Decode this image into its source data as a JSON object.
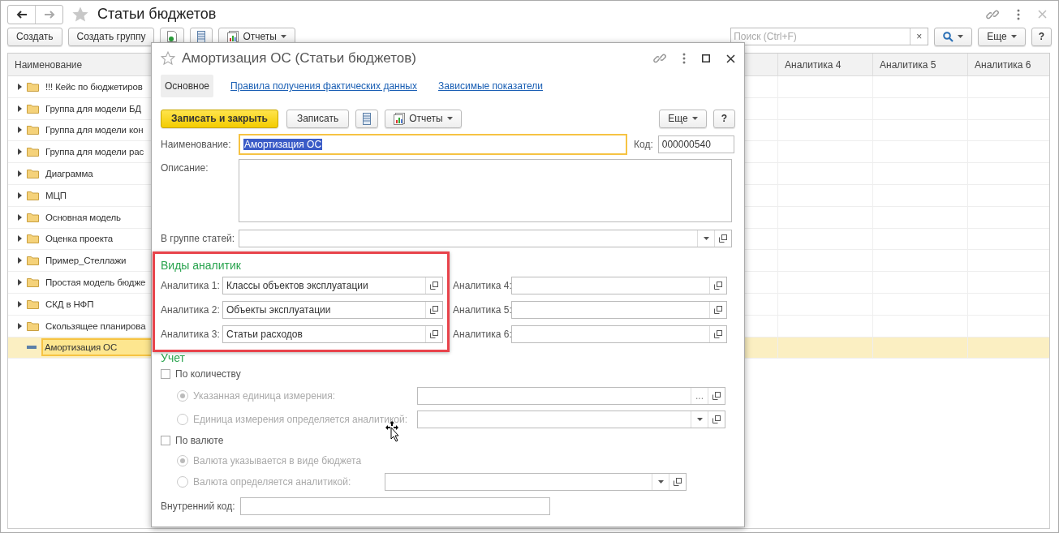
{
  "window": {
    "title": "Статьи бюджетов",
    "favorite": false
  },
  "toolbar": {
    "buttons": [
      "Создать",
      "Создать группу"
    ],
    "reports": "Отчеты",
    "search": {
      "placeholder": "Поиск (Ctrl+F)",
      "clear": "×"
    },
    "more": "Еще",
    "help": "?"
  },
  "table": {
    "columns": [
      "Наименование",
      "Аналитика 4",
      "Аналитика 5",
      "Аналитика 6"
    ],
    "rows": [
      {
        "name": "!!! Кейс по бюджетиров",
        "kind": "group",
        "selected": false
      },
      {
        "name": "Группа для модели БД",
        "kind": "group",
        "selected": false
      },
      {
        "name": "Группа для модели кон",
        "kind": "group",
        "selected": false
      },
      {
        "name": "Группа для модели рас",
        "kind": "group",
        "selected": false
      },
      {
        "name": "Диаграмма",
        "kind": "group",
        "selected": false
      },
      {
        "name": "МЦП",
        "kind": "group",
        "selected": false
      },
      {
        "name": "Основная модель",
        "kind": "group",
        "selected": false
      },
      {
        "name": "Оценка проекта",
        "kind": "group",
        "selected": false
      },
      {
        "name": "Пример_Стеллажи",
        "kind": "group",
        "selected": false
      },
      {
        "name": "Простая модель бюдже",
        "kind": "group",
        "selected": false
      },
      {
        "name": "СКД в НФП",
        "kind": "group",
        "selected": false
      },
      {
        "name": "Скользящее планирова",
        "kind": "group",
        "selected": false
      },
      {
        "name": "Амортизация ОС",
        "kind": "item",
        "selected": true
      }
    ]
  },
  "dialog": {
    "title": "Амортизация ОС (Статьи бюджетов)",
    "favorite": false,
    "tabs": [
      {
        "label": "Основное",
        "selected": true
      },
      {
        "label": "Правила получения фактических данных",
        "selected": false
      },
      {
        "label": "Зависимые показатели",
        "selected": false
      }
    ],
    "toolbar": {
      "save_close": "Записать и закрыть",
      "save": "Записать",
      "reports": "Отчеты",
      "more": "Еще",
      "help": "?"
    },
    "name": {
      "label": "Наименование:",
      "value": "Амортизация ОС",
      "focused": true,
      "value_selected": true
    },
    "code": {
      "label": "Код:",
      "value": "000000540"
    },
    "description": {
      "label": "Описание:"
    },
    "group": {
      "label": "В группе статей:"
    },
    "analytics": {
      "title": "Виды аналитик",
      "highlighted": true,
      "items": [
        {
          "label": "Аналитика 1:",
          "value": "Классы объектов эксплуатации"
        },
        {
          "label": "Аналитика 4:"
        },
        {
          "label": "Аналитика 2:",
          "value": "Объекты эксплуатации"
        },
        {
          "label": "Аналитика 5:"
        },
        {
          "label": "Аналитика 3:",
          "value": "Статьи расходов"
        },
        {
          "label": "Аналитика 6:"
        }
      ]
    },
    "accounting": {
      "title": "Учет",
      "groups": [
        {
          "label": "По количеству",
          "checked": false,
          "options": [
            {
              "label": "Указанная единица измерения:",
              "selected": true,
              "disabled": true,
              "kind": "choice",
              "choose": "..."
            },
            {
              "label": "Единица измерения определяется аналитикой:",
              "selected": false,
              "disabled": true,
              "kind": "dropdown"
            }
          ]
        },
        {
          "label": "По валюте",
          "checked": false,
          "options": [
            {
              "label": "Валюта указывается в виде бюджета",
              "selected": true,
              "disabled": true,
              "kind": "none"
            },
            {
              "label": "Валюта определяется аналитикой:",
              "selected": false,
              "disabled": true,
              "kind": "dropdown"
            }
          ]
        }
      ]
    },
    "internal_code": {
      "label": "Внутренний код:"
    }
  }
}
